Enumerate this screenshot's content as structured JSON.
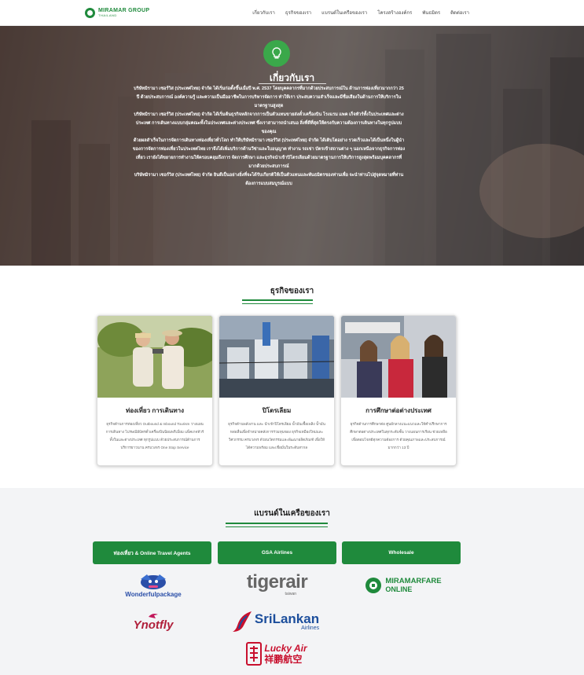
{
  "nav": {
    "logo_line1": "MIRAMAR GROUP",
    "logo_line2": "THAILAND",
    "items": [
      "เกี่ยวกับเรา",
      "ธุรกิจของเรา",
      "แบรนด์ในเครือของเรา",
      "โครงสร้างองค์กร",
      "พันธมิตร",
      "ติดต่อเรา"
    ]
  },
  "hero": {
    "icon": "lightbulb-icon",
    "title": "เกี่ยวกับเรา",
    "paragraphs": [
      "บริษัทมิรามา เซอร์วิส (ประเทศไทย) จำกัด ได้เริ่มก่อตั้งขึ้นเมื่อปี พ.ศ. 2537 โดยบุคคลากรที่มากด้วยประสบการณ์ใน ด้านการท่องเที่ยวมากกว่า 25 ปี ด้วยประสบการณ์ องค์ความรู้ และความเป็นมืออาชีพในการบริหารจัดการ ทำให้เรา ประสบความสำเร็จและมีชื่อเสียงในด้านการให้บริการในมาตรฐานสูงสุด",
      "บริษัทมิรามา เซอร์วิส (ประเทศไทย) จำกัด ได้เริ่มต้นธุรกิจหลักจากการเป็นตัวแทนขายส่งตั๋วเครื่องบิน โรงแรม แพค เก็จทัวร์ทั้งในประเทศและต่างประเทศ การเดินทางแบบกลุ่มคณะทั้งในประเทศและต่างประเทศ ซึ่งเราสามารถนำเสนอ สิ่งที่ดีที่สุดให้ตรงกับความต้องการเดินทางในทุกรูปแบบของคุณ",
      "ด้วยผลสำเร็จในการจัดการเดินทางท่องเที่ยวทั่วโลก ทำให้บริษัทมิรามา เซอร์วิส (ประเทศไทย) จำกัด ได้เติบโตอย่าง รวดเร็วและได้เป็นหนึ่งในผู้นำของการจัดการท่องเที่ยวในประเทศไทย เราจึงได้เพิ่มบริการด้านวีซ่าและใบอนุญาต ทำงาน รถเช่า บัตรเข้าสถานต่าง ๆ นอกเหนือจากธุรกิจการท่องเที่ยว เรายังได้ขยายการทำงานให้ครอบคลุมถึงการ จัดการศึกษา และธุรกิจนำเข้าปิโตรเลียมด้วยมาตรฐานการให้บริการสูงสุดพร้อมบุคคลากรที่มากด้วยประสบการณ์",
      "บริษัทมิรามา เซอร์วิส (ประเทศไทย) จำกัด ยินดีเป็นอย่างยิ่งที่จะได้รับเกียรติให้เป็นตัวแทนและพันธมิตรของท่านเพื่อ จะนำท่านไปสู่จุดหมายที่ท่านต้องการแบบสมบูรณ์แบบ"
    ]
  },
  "business": {
    "title": "ธุรกิจของเรา",
    "cards": [
      {
        "title": "ท่องเที่ยว การเดินทาง",
        "description": "ธุรกิจด้านการท่องเที่ยว Outbound & Inbound Tourism วางแผนการเดินทาง ไปรษณีย์บัตรตั๋วเครื่องบินนิยมพรีเมี่ยม แพ็คเกจทัวร์ ทั้งในและต่างประเทศ ทุกรูปแบบ ด้วยประสบการณ์ด้านการบริการยาวนาน ครบวงจร One Stop Service"
      },
      {
        "title": "ปิโตรเลียม",
        "description": "ธุรกิจด้านพลังงาน และ นำเข้าปิโตรเลียม น้ำมันเชื้อเพลิง น้ำมันหล่อลื่นเพื่อจำหน่ายคลังการร่วมทุนของ ธุรกิจเหมืองใหม่และวิศวกรรม ครบวงจร ด้วยนวัตกรรมและพัฒนาผลิตภัณฑ์ เพื่อให้ได้ความพร้อม และเชื่อมั่นในระดับสากล"
      },
      {
        "title": "การศึกษาต่อต่างประเทศ",
        "description": "ธุรกิจด้านการศึกษาต่อ ศูนย์กลางแนะแนวและให้คำปรึกษาการศึกษาต่อต่างประเทศในทุกระดับชั้น วางแผนการเรียน ช่วยเหลือ เพื่อตอบโจทย์ทุกความต้องการ ด้วยคุณภาพและประสบการณ์มากกว่า 13 ปี"
      }
    ]
  },
  "brands": {
    "title": "แบรนด์ในเครือของเรา",
    "tabs": [
      "ท่องเที่ยว & Online Travel Agents",
      "GSA Airlines",
      "Wholesale"
    ],
    "logos": {
      "wonderful": "Wonderfulpackage",
      "tiger": "tigerair",
      "tiger_sub": "taiwan",
      "miramarfare": "MIRAMARFARE",
      "miramarfare_sub": "ONLINE",
      "ynot": "Ynotfly",
      "srilankan": "SriLankan",
      "srilankan_sub": "Airlines",
      "lucky": "Lucky Air",
      "lucky_cn": "祥鹏航空"
    },
    "colors": {
      "green": "#1f8a3c",
      "tiger": "#666666",
      "ynot": "#b01f3a",
      "srilankan": "#1c4e9c",
      "lucky": "#c8102e"
    }
  }
}
